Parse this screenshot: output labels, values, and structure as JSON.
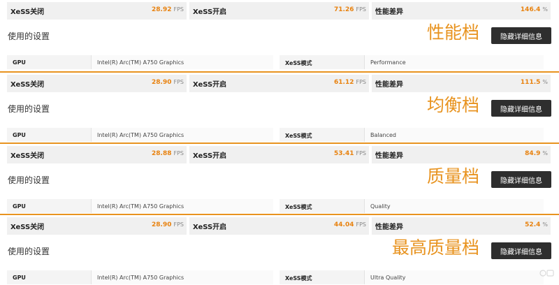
{
  "labels": {
    "xess_off": "XeSS关闭",
    "xess_on": "XeSS开启",
    "perf_diff": "性能差异",
    "fps_unit": "FPS",
    "percent_unit": "%",
    "settings_title": "使用的设置",
    "details_button": "隐藏详细信息",
    "gpu_key": "GPU",
    "mode_key": "XeSS模式"
  },
  "colors": {
    "accent": "#e8931f",
    "value": "#e8820f",
    "button": "#2e2e2e"
  },
  "blocks": [
    {
      "mode_label": "性能档",
      "xess_off_fps": "28.92",
      "xess_on_fps": "71.26",
      "perf_diff": "146.4",
      "gpu": "Intel(R) Arc(TM) A750 Graphics",
      "xess_mode": "Performance"
    },
    {
      "mode_label": "均衡档",
      "xess_off_fps": "28.90",
      "xess_on_fps": "61.12",
      "perf_diff": "111.5",
      "gpu": "Intel(R) Arc(TM) A750 Graphics",
      "xess_mode": "Balanced"
    },
    {
      "mode_label": "质量档",
      "xess_off_fps": "28.88",
      "xess_on_fps": "53.41",
      "perf_diff": "84.9",
      "gpu": "Intel(R) Arc(TM) A750 Graphics",
      "xess_mode": "Quality"
    },
    {
      "mode_label": "最高质量档",
      "xess_off_fps": "28.90",
      "xess_on_fps": "44.04",
      "perf_diff": "52.4",
      "gpu": "Intel(R) Arc(TM) A750 Graphics",
      "xess_mode": "Ultra Quality"
    }
  ],
  "watermark_icon": "site-watermark-icon"
}
